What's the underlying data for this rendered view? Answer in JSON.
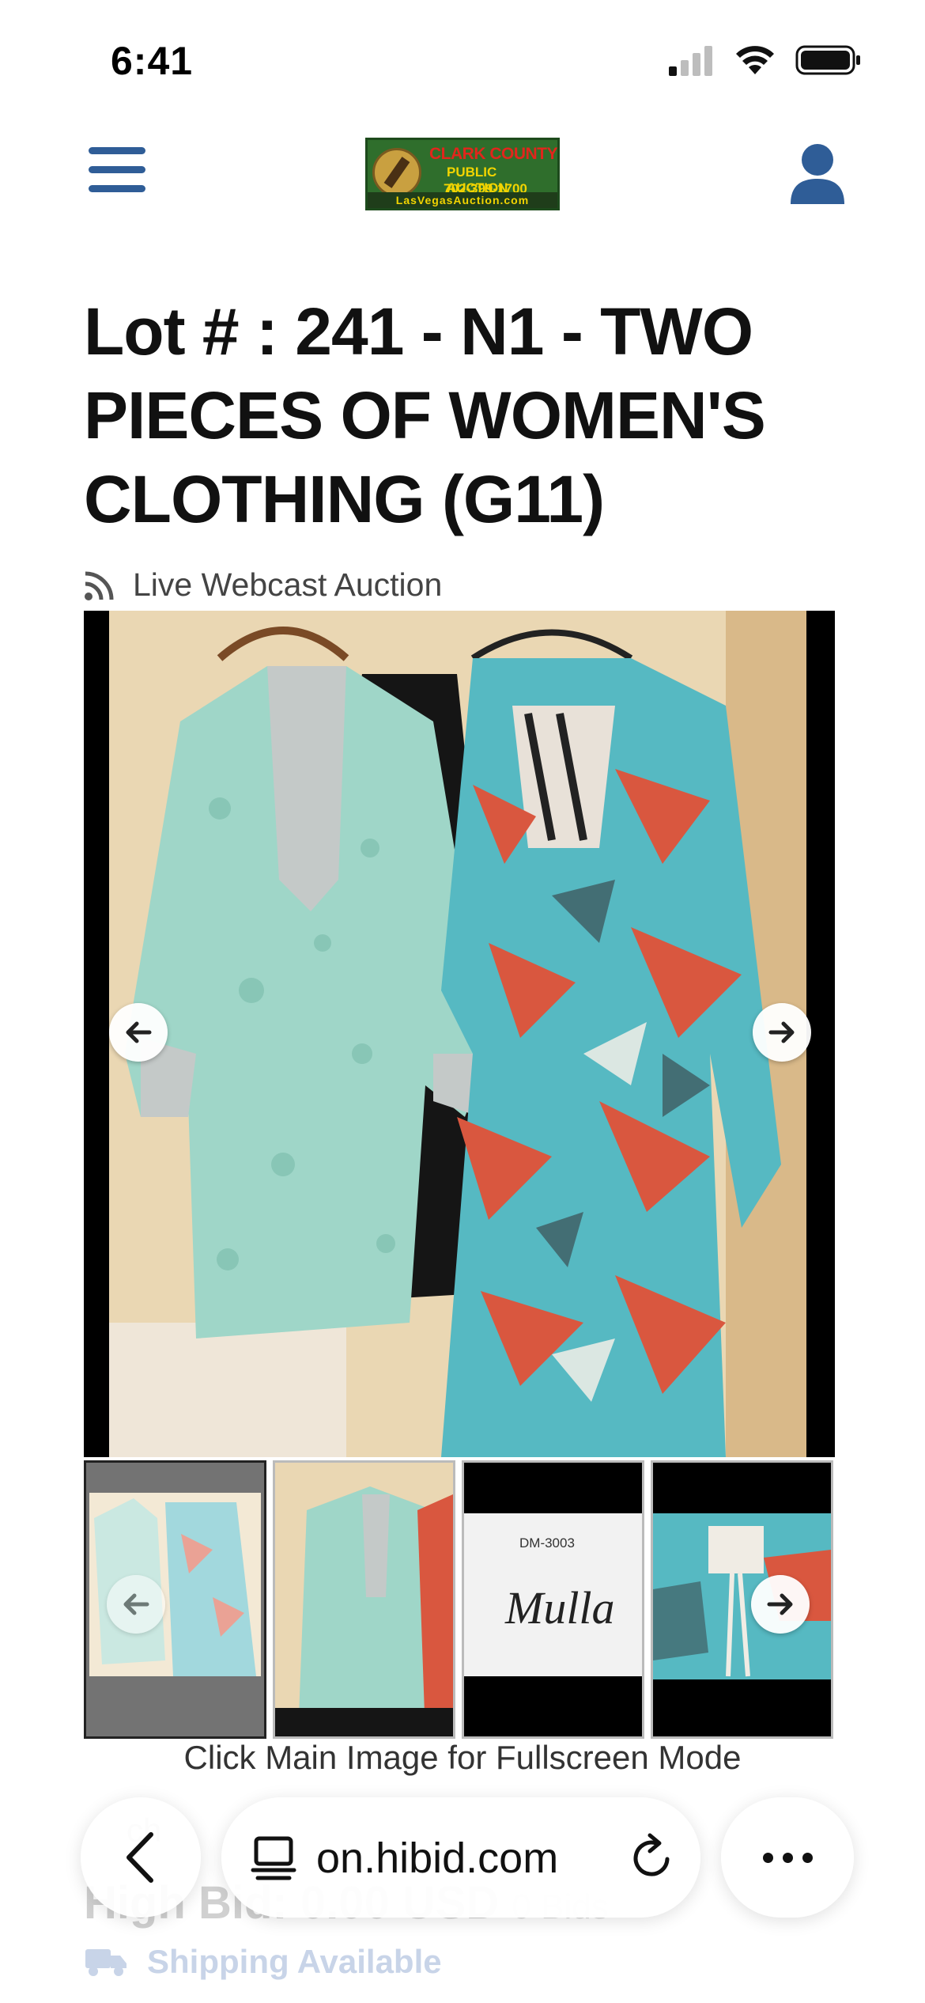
{
  "status_bar": {
    "time": "6:41"
  },
  "header": {
    "logo": {
      "line1": "CLARK COUNTY",
      "line2": "PUBLIC AUCTION",
      "line3": "702-399-1700",
      "strip": "LasVegasAuction.com"
    }
  },
  "lot": {
    "title": "Lot # : 241 - N1 - TWO PIECES OF WOMEN'S CLOTHING (G11)",
    "auction_type": "Live Webcast Auction"
  },
  "gallery": {
    "thumbnail_count": 4,
    "thumb_label_1": "DM-3003",
    "thumb_brand": "Mulla",
    "hint": "Click Main Image for Fullscreen Mode"
  },
  "underlying": {
    "search_partial": "ch",
    "high_bid": "High Bid: 0.00 USD",
    "bid_count": "0 Bids",
    "shipping": "Shipping Available"
  },
  "browser": {
    "url": "on.hibid.com"
  },
  "colors": {
    "brand_blue": "#2f5d97",
    "dress_teal": "#56b9c2",
    "lace_mint": "#9fd6c8",
    "print_coral": "#d9573f"
  }
}
